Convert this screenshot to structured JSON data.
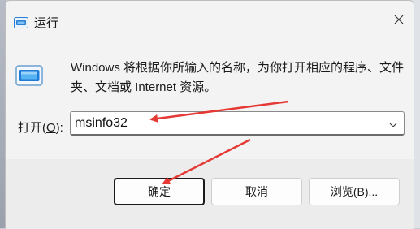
{
  "window": {
    "title": "运行",
    "description": "Windows 将根据你所输入的名称，为你打开相应的程序、文件夹、文档或 Internet 资源。"
  },
  "open": {
    "label_prefix": "打开(",
    "label_accel": "O",
    "label_suffix": "):",
    "value": "msinfo32"
  },
  "buttons": {
    "ok": "确定",
    "cancel": "取消",
    "browse": "浏览(B)..."
  },
  "annotations": {
    "arrow_color": "#e53935"
  }
}
